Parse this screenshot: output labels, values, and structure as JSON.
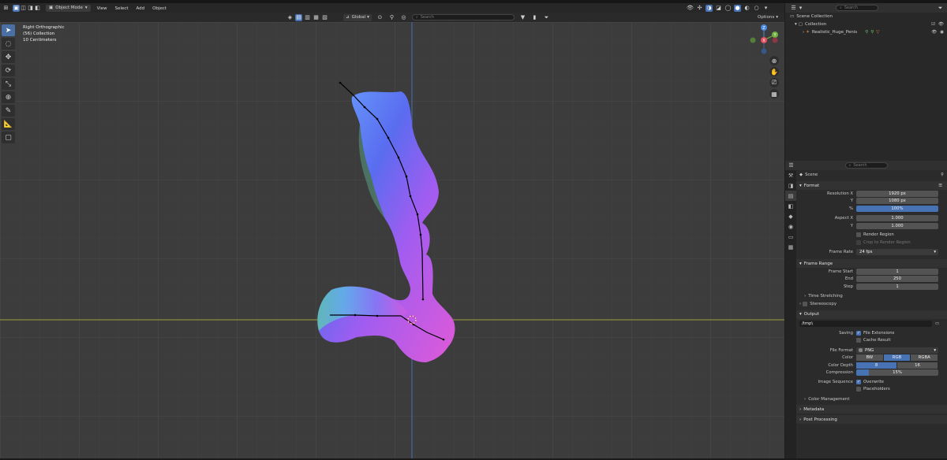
{
  "header": {
    "mode": "Object Mode",
    "menus": [
      "View",
      "Select",
      "Add",
      "Object"
    ],
    "transform": "Global",
    "search_placeholder": "Search",
    "options": "Options"
  },
  "viewport": {
    "view_name": "Right Orthographic",
    "collection": "(56) Collection",
    "units": "10 Centimeters",
    "gizmo_labels": [
      "Z",
      "Y",
      "X"
    ]
  },
  "outliner": {
    "search_placeholder": "Search",
    "scene_collection": "Scene Collection",
    "collection": "Collection",
    "object": "Realistic_Huge_Penis"
  },
  "properties": {
    "search_placeholder": "Search",
    "context": "Scene",
    "format": {
      "title": "Format",
      "res_x_label": "Resolution X",
      "res_x": "1920 px",
      "res_y_label": "Y",
      "res_y": "1080 px",
      "pct_label": "%",
      "pct": "100%",
      "aspect_x_label": "Aspect X",
      "aspect_x": "1.000",
      "aspect_y_label": "Y",
      "aspect_y": "1.000",
      "render_region": "Render Region",
      "crop": "Crop to Render Region",
      "frame_rate_label": "Frame Rate",
      "frame_rate": "24 fps"
    },
    "frame_range": {
      "title": "Frame Range",
      "start_label": "Frame Start",
      "start": "1",
      "end_label": "End",
      "end": "250",
      "step_label": "Step",
      "step": "1",
      "time_stretching": "Time Stretching",
      "stereoscopy": "Stereoscopy"
    },
    "output": {
      "title": "Output",
      "path": "/tmp\\",
      "saving_label": "Saving",
      "file_extensions": "File Extensions",
      "cache_result": "Cache Result",
      "file_format_label": "File Format",
      "file_format": "PNG",
      "color_label": "Color",
      "color_options": [
        "BW",
        "RGB",
        "RGBA"
      ],
      "depth_label": "Color Depth",
      "depth_options": [
        "8",
        "16"
      ],
      "compression_label": "Compression",
      "compression": "15%",
      "compression_value": 0.15,
      "image_seq_label": "Image Sequence",
      "overwrite": "Overwrite",
      "placeholders": "Placeholders",
      "color_management": "Color Management"
    },
    "metadata": "Metadata",
    "post_processing": "Post Processing"
  },
  "colors": {
    "accent": "#4772b3",
    "viewport_bg": "#3c3c3c",
    "gizmo_x": "#e05060",
    "gizmo_y": "#70b040",
    "gizmo_z": "#4a88e0"
  }
}
